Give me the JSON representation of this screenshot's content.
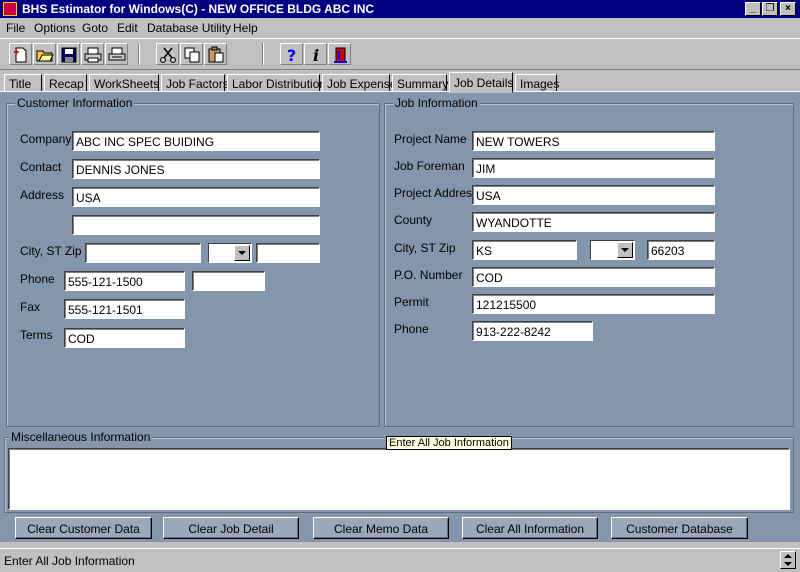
{
  "window": {
    "title": "BHS Estimator for Windows(C) - NEW OFFICE BLDG ABC INC",
    "controls": [
      "minimize",
      "restore",
      "close"
    ]
  },
  "menu": [
    "File",
    "Options",
    "Goto",
    "Edit",
    "Database Utility",
    "Help"
  ],
  "toolbar": {
    "icons": [
      "new-icon",
      "open-folder-icon",
      "save-icon",
      "print-icon",
      "print-preview-icon",
      "cut-icon",
      "copy-icon",
      "paste-icon",
      "help-icon",
      "info-icon",
      "exit-door-icon"
    ]
  },
  "tabs": [
    "Title",
    "Recap",
    "WorkSheets",
    "Job Factors",
    "Labor Distribution",
    "Job Expense",
    "Summary",
    "Job Details",
    "Images"
  ],
  "active_tab": "Job Details",
  "customer": {
    "title": "Customer Information",
    "company_label": "Company",
    "company": "ABC INC SPEC BUIDING",
    "contact_label": "Contact",
    "contact": "DENNIS JONES",
    "address_label": "Address",
    "address1": "USA",
    "address2": "",
    "city_label": "City, ST  Zip",
    "city": "",
    "state": "",
    "zip": "",
    "phone_label": "Phone",
    "phone": "555-121-1500",
    "phone_ext": "",
    "fax_label": "Fax",
    "fax": "555-121-1501",
    "terms_label": "Terms",
    "terms": "COD"
  },
  "job": {
    "title": "Job Information",
    "project_name_label": "Project Name",
    "project_name": "NEW TOWERS",
    "job_foreman_label": "Job Foreman",
    "job_foreman": "JIM",
    "project_address_label": "Project Addres",
    "project_address": "USA",
    "county_label": "County",
    "county": "WYANDOTTE",
    "city_label": "City, ST  Zip",
    "city": "KS",
    "state": "",
    "zip": "66203",
    "po_label": "P.O. Number",
    "po": "COD",
    "permit_label": "Permit",
    "permit": "121215500",
    "phone_label": "Phone",
    "phone": "913-222-8242"
  },
  "misc": {
    "title": "Miscellaneous Information",
    "text": ""
  },
  "tooltip": "Enter All Job Information",
  "buttons": {
    "clear_customer": "Clear Customer Data",
    "clear_job": "Clear Job Detail",
    "clear_memo": "Clear Memo Data",
    "clear_all": "Clear All Information",
    "customer_db": "Customer Database"
  },
  "status": "Enter All Job Information"
}
